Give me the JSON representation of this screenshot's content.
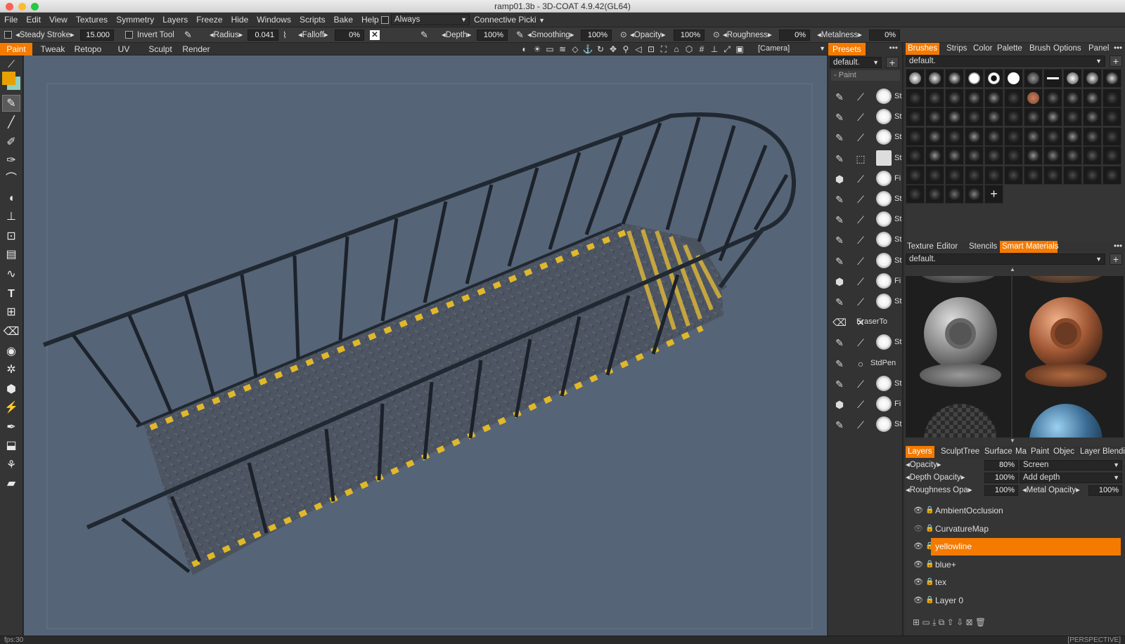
{
  "window": {
    "title": "ramp01.3b - 3D-COAT 4.9.42(GL64)"
  },
  "menu": [
    "File",
    "Edit",
    "View",
    "Textures",
    "Symmetry",
    "Layers",
    "Freeze",
    "Hide",
    "Windows",
    "Scripts",
    "Bake",
    "Help"
  ],
  "menu_extra": {
    "always_label": "Always",
    "connective_label": "Connective Picki"
  },
  "tool_options": {
    "steady_stroke": "Steady Stroke",
    "steady_value": "15.000",
    "invert_tool": "Invert Tool",
    "radius_label": "Radius",
    "radius_value": "0.041",
    "falloff_label": "Falloff",
    "falloff_value": "0%",
    "depth_label": "Depth",
    "depth_value": "100%",
    "smoothing_label": "Smoothing",
    "smoothing_value": "100%",
    "opacity_label": "Opacity",
    "opacity_value": "100%",
    "roughness_label": "Roughness",
    "roughness_value": "0%",
    "metalness_label": "Metalness",
    "metalness_value": "0%"
  },
  "rooms": [
    "Paint",
    "Tweak",
    "Retopo",
    "UV",
    "Sculpt",
    "Render"
  ],
  "viewport": {
    "camera_label": "[Camera]",
    "projection": "[PERSPECTIVE]"
  },
  "presets": {
    "header": "Presets",
    "dropdown": "default.",
    "section": "- Paint",
    "rows": [
      "St",
      "St",
      "St",
      "St",
      "Fi",
      "St",
      "St",
      "St",
      "St",
      "Fi",
      "St",
      "EraserTo",
      "St",
      "StdPen",
      "St",
      "Fi",
      "St"
    ]
  },
  "brush_panel": {
    "tabs": [
      "Brushes",
      "Strips",
      "Color",
      "Palette",
      "Brush",
      "Options",
      "Panel"
    ],
    "dropdown": "default."
  },
  "materials_panel": {
    "tabs": [
      "Texture",
      "Editor",
      "Stencils",
      "Smart",
      "Materials"
    ],
    "dropdown": "default."
  },
  "layers_panel": {
    "tabs": [
      "Layers",
      "SculptTree",
      "Surface",
      "Ma",
      "Paint",
      "Objec",
      "Layer",
      "Blendi"
    ],
    "opacity_label": "Opacity",
    "opacity_value": "80%",
    "blend_mode": "Screen",
    "depth_opacity_label": "Depth Opacity",
    "depth_opacity_value": "100%",
    "depth_mode": "Add depth",
    "roughness_opacity_label": "Roughness Opa",
    "roughness_opacity_value": "100%",
    "metal_opacity_label": "Metal Opacity",
    "metal_opacity_value": "100%",
    "layers": [
      {
        "name": "AmbientOcclusion",
        "selected": false
      },
      {
        "name": "CurvatureMap",
        "selected": false
      },
      {
        "name": "yellowline",
        "selected": true
      },
      {
        "name": "blue+",
        "selected": false
      },
      {
        "name": "tex",
        "selected": false
      },
      {
        "name": "Layer 0",
        "selected": false
      }
    ]
  },
  "status": {
    "fps": "fps:30"
  },
  "colors": {
    "accent": "#f47a00",
    "primary_color": "#e8a000",
    "secondary_color": "#8fd0c0",
    "viewport_bg": "#566477"
  }
}
